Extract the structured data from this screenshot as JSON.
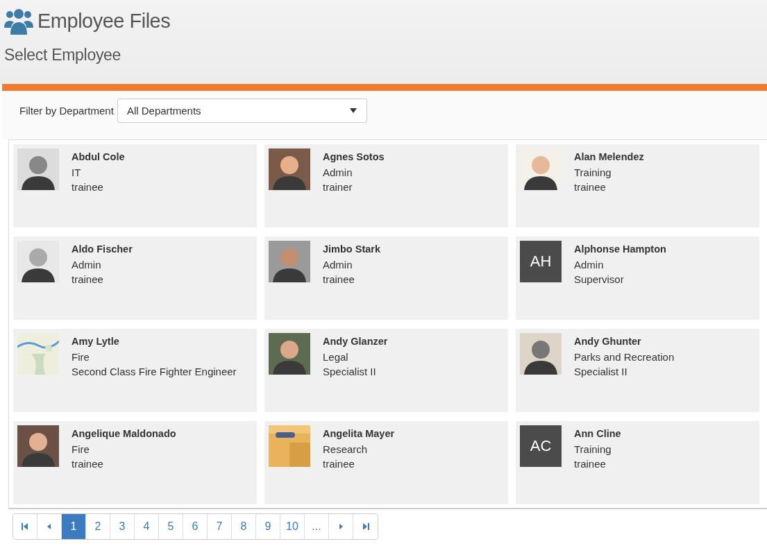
{
  "header": {
    "title": "Employee Files",
    "subtitle": "Select Employee"
  },
  "filter": {
    "label": "Filter by Department",
    "value": "All Departments"
  },
  "employees": [
    {
      "name": "Abdul Cole",
      "department": "IT",
      "role": "trainee"
    },
    {
      "name": "Agnes Sotos",
      "department": "Admin",
      "role": "trainer"
    },
    {
      "name": "Alan Melendez",
      "department": "Training",
      "role": "trainee"
    },
    {
      "name": "Aldo Fischer",
      "department": "Admin",
      "role": "trainee"
    },
    {
      "name": "Jimbo Stark",
      "department": "Admin",
      "role": "trainee"
    },
    {
      "name": "Alphonse Hampton",
      "department": "Admin",
      "role": "Supervisor",
      "avatar": {
        "kind": "initials",
        "text": "AH"
      }
    },
    {
      "name": "Amy Lytle",
      "department": "Fire",
      "role": "Second Class Fire Fighter Engineer"
    },
    {
      "name": "Andy Glanzer",
      "department": "Legal",
      "role": "Specialist II"
    },
    {
      "name": "Andy Ghunter",
      "department": "Parks and Recreation",
      "role": "Specialist II"
    },
    {
      "name": "Angelique Maldonado",
      "department": "Fire",
      "role": "trainee"
    },
    {
      "name": "Angelita Mayer",
      "department": "Research",
      "role": "trainee"
    },
    {
      "name": "Ann Cline",
      "department": "Training",
      "role": "trainee",
      "avatar": {
        "kind": "initials",
        "text": "AC"
      }
    }
  ],
  "pagination": {
    "pages": [
      {
        "label": "1",
        "selected": true
      },
      {
        "label": "2",
        "selected": false
      },
      {
        "label": "3",
        "selected": false
      },
      {
        "label": "4",
        "selected": false
      },
      {
        "label": "5",
        "selected": false
      },
      {
        "label": "6",
        "selected": false
      },
      {
        "label": "7",
        "selected": false
      },
      {
        "label": "8",
        "selected": false
      },
      {
        "label": "9",
        "selected": false
      },
      {
        "label": "10",
        "selected": false
      },
      {
        "label": "...",
        "selected": false
      }
    ]
  }
}
